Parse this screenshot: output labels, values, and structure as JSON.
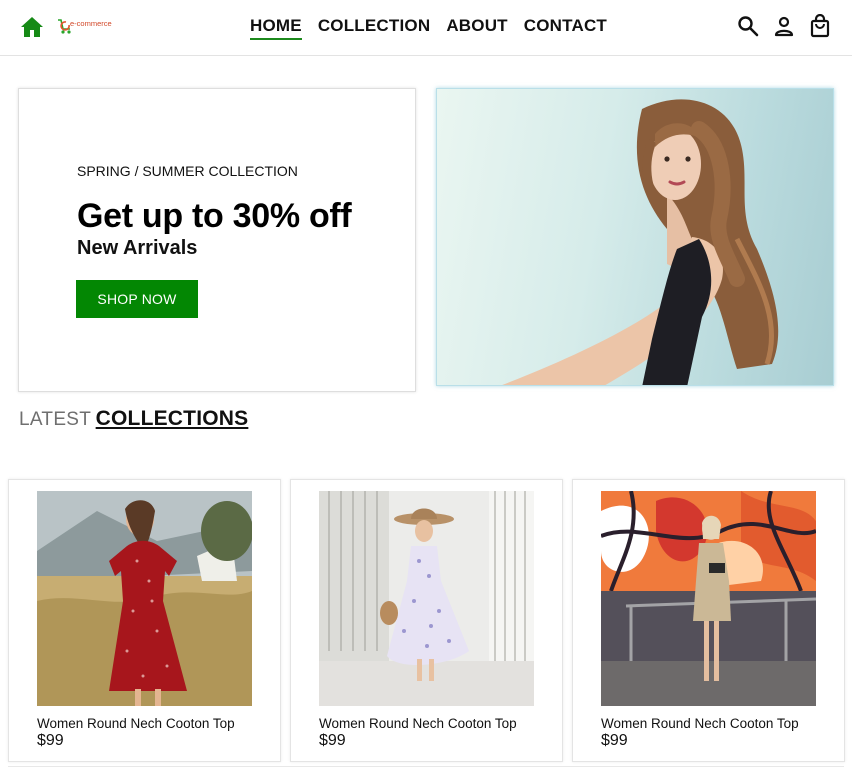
{
  "header": {
    "logo_text": "e-commerce",
    "nav": [
      {
        "label": "HOME",
        "active": true
      },
      {
        "label": "COLLECTION",
        "active": false
      },
      {
        "label": "ABOUT",
        "active": false
      },
      {
        "label": "CONTACT",
        "active": false
      }
    ],
    "icons": [
      "search-icon",
      "user-icon",
      "shopping-bag-icon"
    ]
  },
  "hero": {
    "eyebrow": "SPRING / SUMMER COLLECTION",
    "title": "Get up to 30% off",
    "subtitle": "New Arrivals",
    "cta_label": "SHOP NOW",
    "image_alt": "model-photo"
  },
  "section": {
    "title_light": "LATEST",
    "title_bold": "COLLECTIONS"
  },
  "products": [
    {
      "name": "Women Round Nech Cooton Top",
      "price": "$99"
    },
    {
      "name": "Women Round Nech Cooton Top",
      "price": "$99"
    },
    {
      "name": "Women Round Nech Cooton Top",
      "price": "$99"
    }
  ],
  "colors": {
    "accent_green": "#038703",
    "nav_underline": "#1d8a1d",
    "logo_orange": "#d2492a"
  }
}
